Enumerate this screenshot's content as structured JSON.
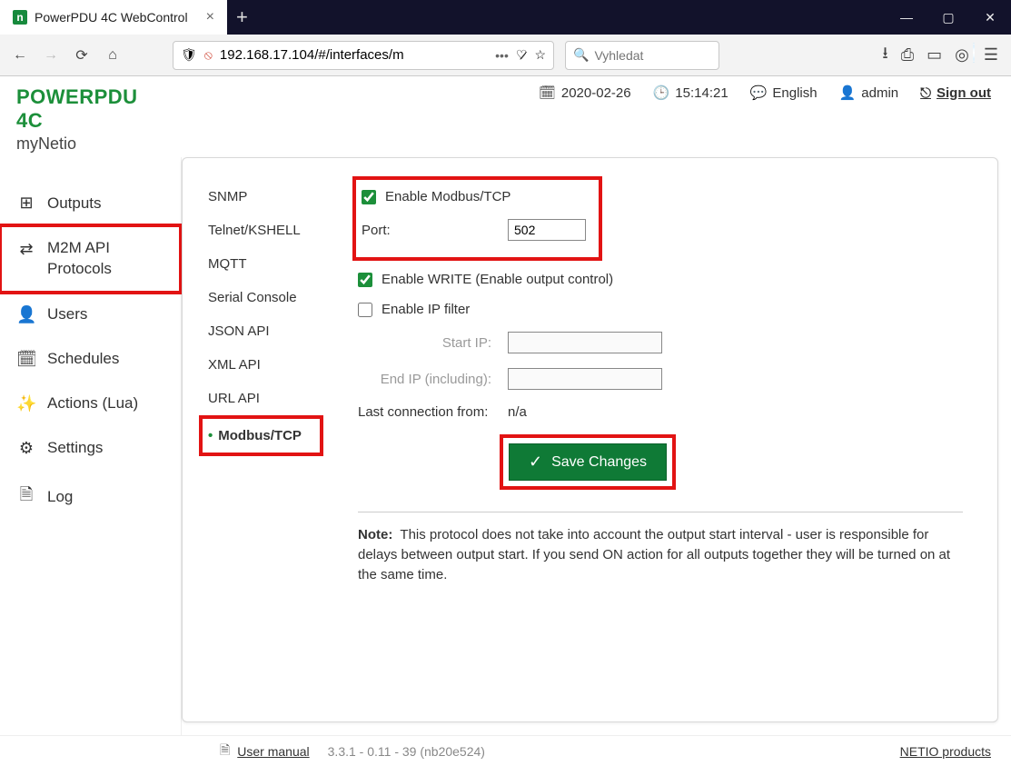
{
  "browser": {
    "tab_title": "PowerPDU 4C WebControl",
    "url": "192.168.17.104/#/interfaces/m",
    "search_placeholder": "Vyhledat"
  },
  "brand": {
    "title": "POWERPDU 4C",
    "subtitle": "myNetio"
  },
  "topbar": {
    "date": "2020-02-26",
    "time": "15:14:21",
    "language": "English",
    "user": "admin",
    "signout": "Sign out"
  },
  "nav": {
    "items": [
      {
        "icon": "⬓",
        "label": "Outputs"
      },
      {
        "icon": "✣",
        "label": "M2M API\nProtocols"
      },
      {
        "icon": "⚇",
        "label": "Users"
      },
      {
        "icon": "☷",
        "label": "Schedules"
      },
      {
        "icon": "✦",
        "label": "Actions (Lua)"
      },
      {
        "icon": "⚙",
        "label": "Settings"
      },
      {
        "icon": "🗎",
        "label": "Log"
      }
    ]
  },
  "protocols": {
    "items": [
      "SNMP",
      "Telnet/KSHELL",
      "MQTT",
      "Serial Console",
      "JSON API",
      "XML API",
      "URL API",
      "Modbus/TCP"
    ],
    "active_index": 7
  },
  "form": {
    "enable_modbus_label": "Enable Modbus/TCP",
    "enable_modbus_checked": true,
    "port_label": "Port:",
    "port_value": "502",
    "enable_write_label": "Enable WRITE (Enable output control)",
    "enable_write_checked": true,
    "enable_ipfilter_label": "Enable IP filter",
    "enable_ipfilter_checked": false,
    "start_ip_label": "Start IP:",
    "start_ip_value": "",
    "end_ip_label": "End IP (including):",
    "end_ip_value": "",
    "last_conn_label": "Last connection from:",
    "last_conn_value": "n/a",
    "save_label": "Save Changes",
    "note_label": "Note:",
    "note_text": "This protocol does not take into account the output start interval - user is responsible for delays between output start. If you send ON action for all outputs together they will be turned on at the same time."
  },
  "footer": {
    "manual": "User manual",
    "version": "3.3.1 - 0.11 - 39 (nb20e524)",
    "products": "NETIO products"
  }
}
